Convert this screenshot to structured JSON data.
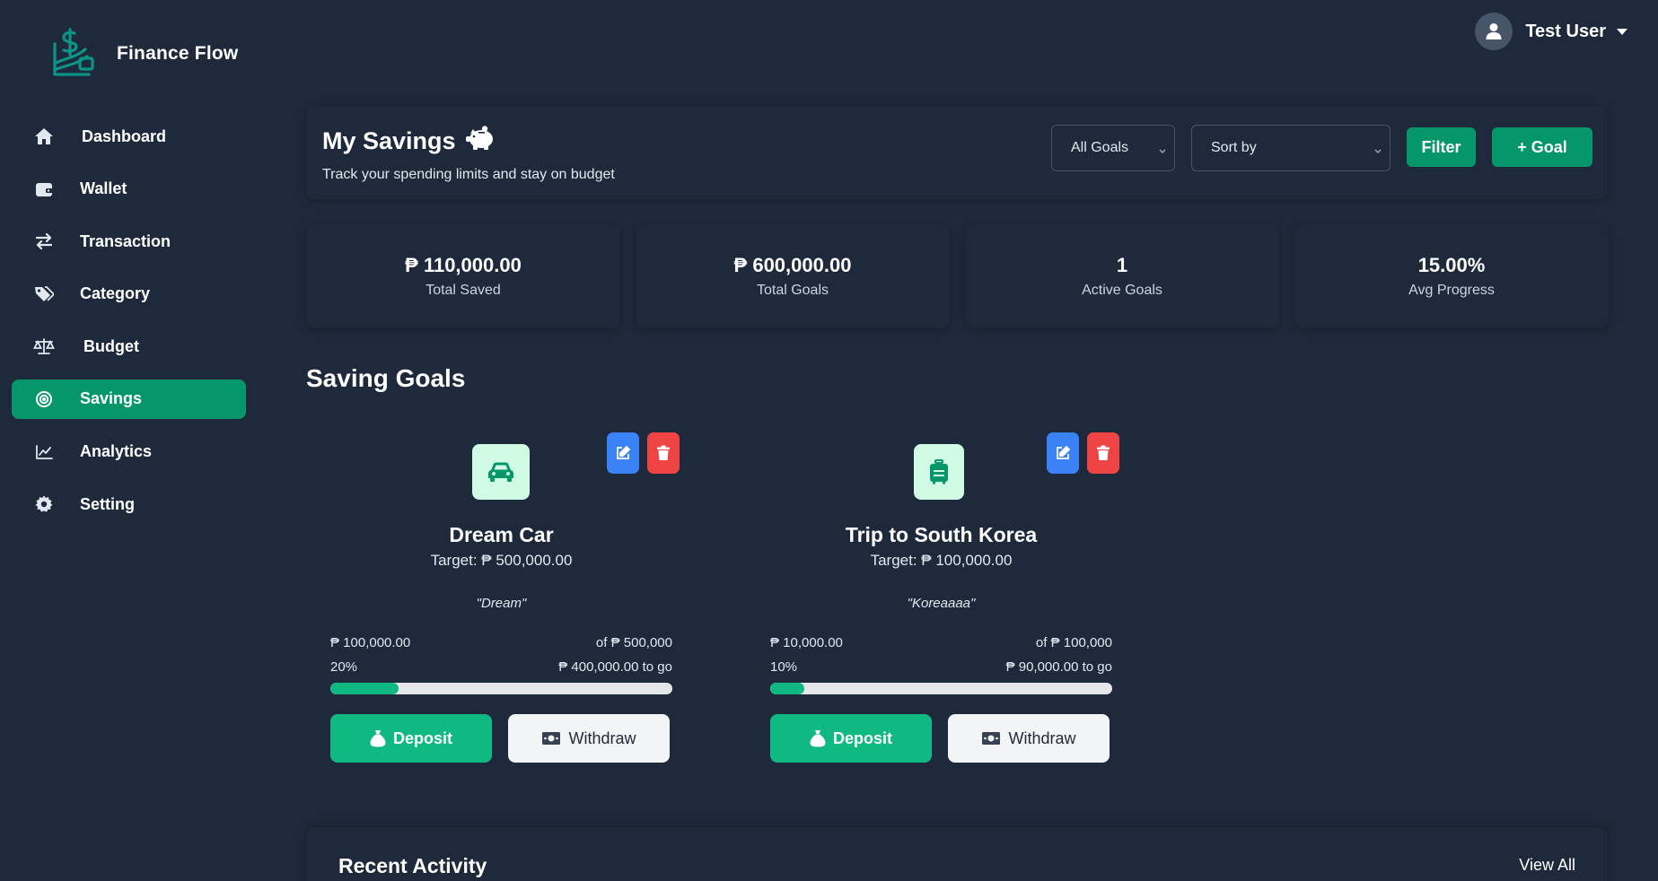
{
  "brand": {
    "name": "Finance Flow",
    "logo_icon": "dollar-wallet-logo-icon",
    "color": "#0d9488"
  },
  "user": {
    "name": "Test User"
  },
  "sidebar": {
    "items": [
      {
        "label": "Dashboard",
        "icon": "home-icon",
        "active": false
      },
      {
        "label": "Wallet",
        "icon": "wallet-icon",
        "active": false
      },
      {
        "label": "Transaction",
        "icon": "exchange-icon",
        "active": false
      },
      {
        "label": "Category",
        "icon": "tags-icon",
        "active": false
      },
      {
        "label": "Budget",
        "icon": "scale-icon",
        "active": false
      },
      {
        "label": "Savings",
        "icon": "target-icon",
        "active": true
      },
      {
        "label": "Analytics",
        "icon": "chart-line-icon",
        "active": false
      },
      {
        "label": "Setting",
        "icon": "gear-icon",
        "active": false
      }
    ]
  },
  "header": {
    "title": "My Savings",
    "title_icon": "piggy-bank-icon",
    "subtitle": "Track your spending limits and stay on budget",
    "goals_select": "All Goals",
    "sort_select": "Sort by",
    "filter_label": "Filter",
    "add_goal_label": "+ Goal"
  },
  "stats": [
    {
      "value": "₱ 110,000.00",
      "label": "Total Saved"
    },
    {
      "value": "₱ 600,000.00",
      "label": "Total Goals"
    },
    {
      "value": "1",
      "label": "Active Goals"
    },
    {
      "value": "15.00%",
      "label": "Avg Progress"
    }
  ],
  "goals_section": {
    "title": "Saving Goals"
  },
  "goals": [
    {
      "icon": "car-icon",
      "name": "Dream Car",
      "target": "Target: ₱ 500,000.00",
      "note": "\"Dream\"",
      "saved": "₱ 100,000.00",
      "of_total": "of ₱ 500,000",
      "percent_text": "20%",
      "to_go": "₱ 400,000.00 to go",
      "progress": 0.2,
      "deposit_label": "Deposit",
      "withdraw_label": "Withdraw"
    },
    {
      "icon": "suitcase-icon",
      "name": "Trip to South Korea",
      "target": "Target: ₱ 100,000.00",
      "note": "\"Koreaaaa\"",
      "saved": "₱ 10,000.00",
      "of_total": "of ₱ 100,000",
      "percent_text": "10%",
      "to_go": "₱ 90,000.00 to go",
      "progress": 0.1,
      "deposit_label": "Deposit",
      "withdraw_label": "Withdraw"
    }
  ],
  "recent": {
    "title": "Recent Activity",
    "view_all": "View All"
  },
  "colors": {
    "background": "#1e293b",
    "accent": "#059669",
    "progress": "#10b981",
    "edit": "#3b82f6",
    "delete": "#ef4444"
  }
}
